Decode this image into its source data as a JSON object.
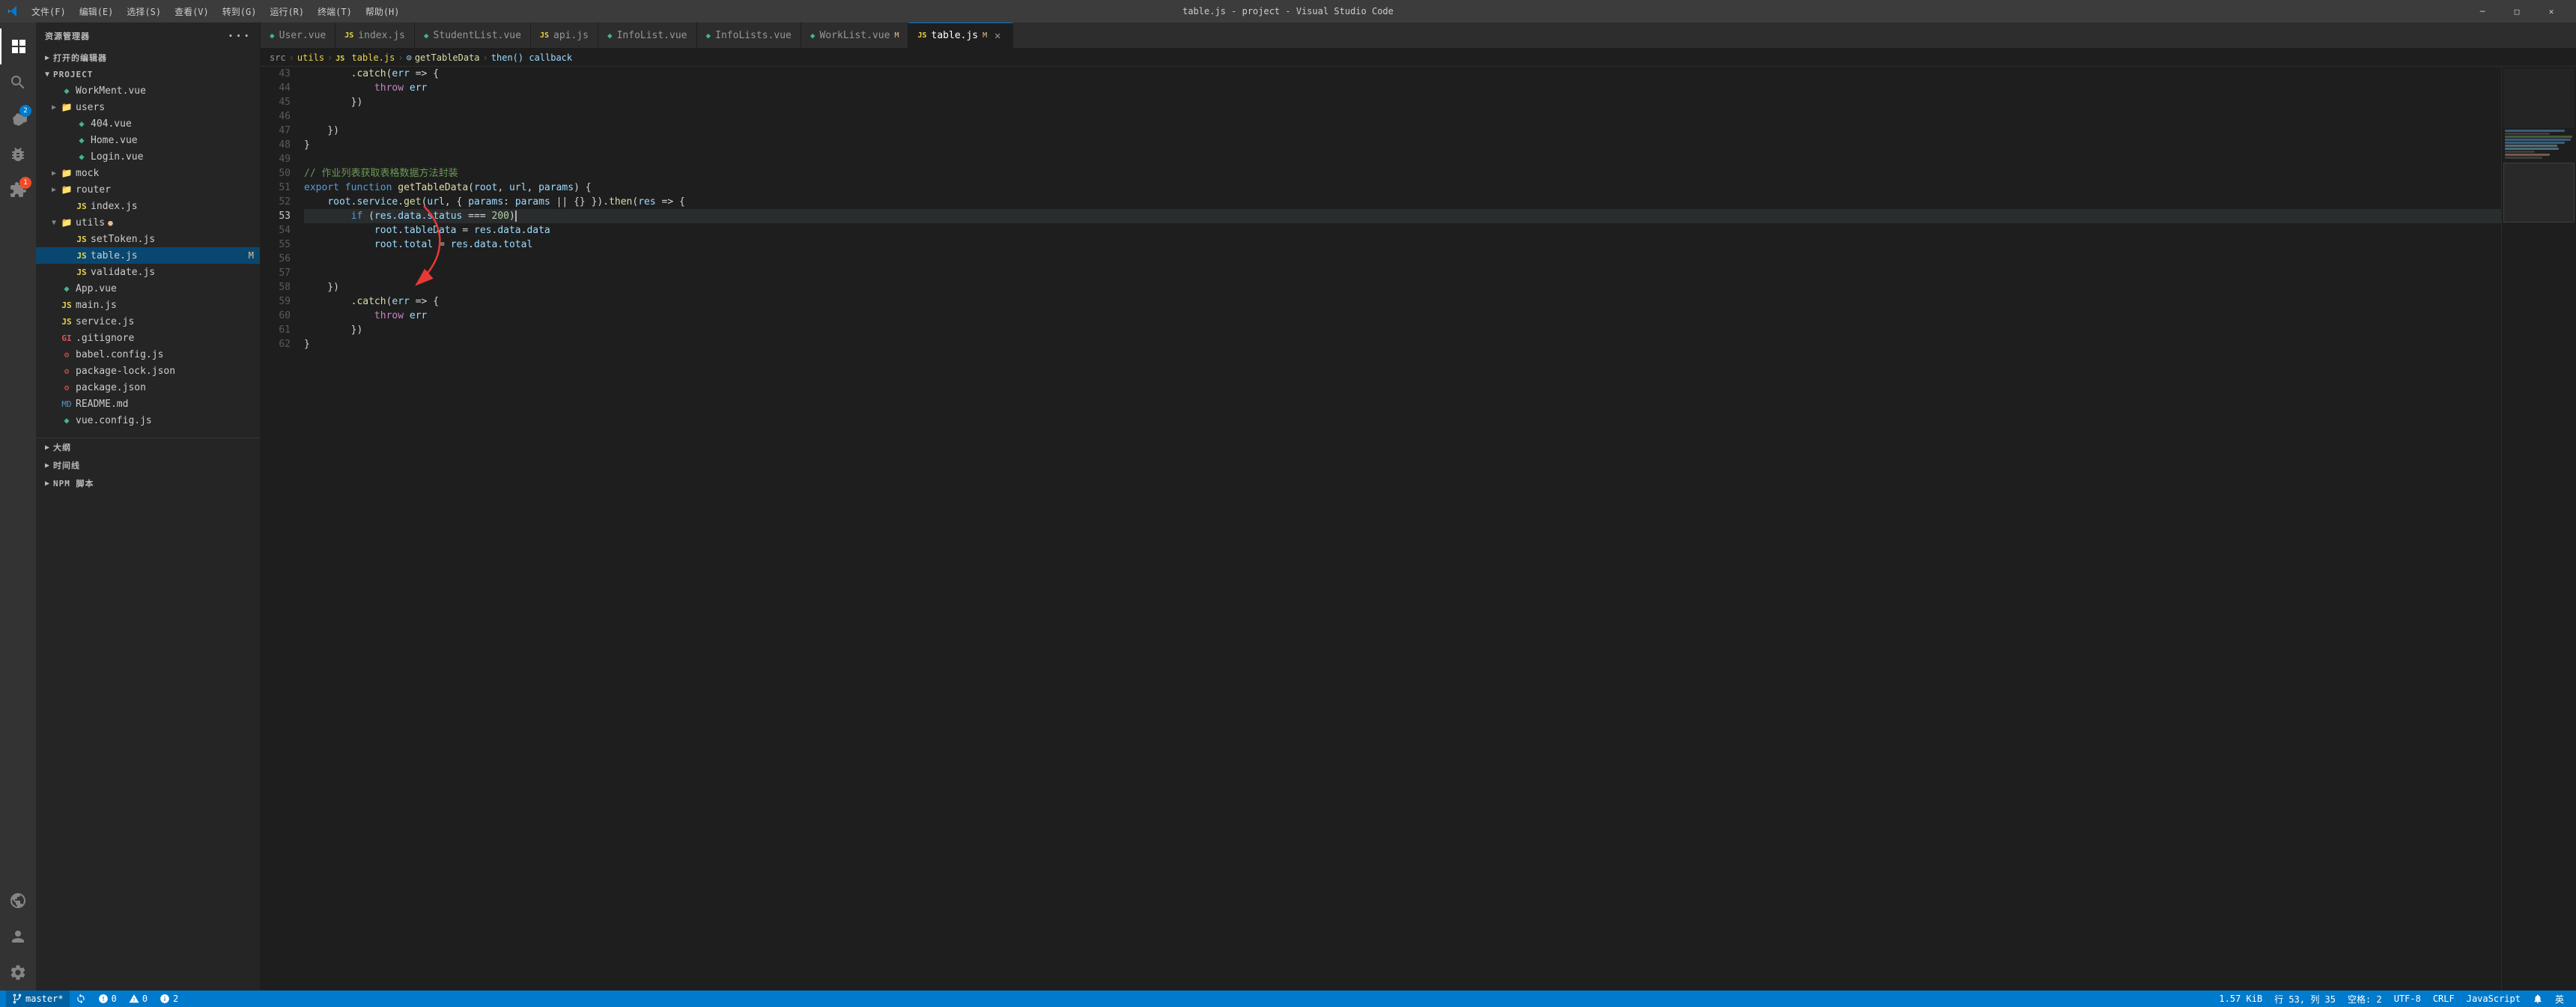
{
  "titleBar": {
    "title": "table.js - project - Visual Studio Code",
    "menus": [
      "文件(F)",
      "编辑(E)",
      "选择(S)",
      "查看(V)",
      "转到(G)",
      "运行(R)",
      "终端(T)",
      "帮助(H)"
    ]
  },
  "tabs": [
    {
      "id": "user-vue",
      "type": "vue",
      "label": "User.vue",
      "active": false,
      "modified": false
    },
    {
      "id": "index-js",
      "type": "js",
      "label": "index.js",
      "active": false,
      "modified": false
    },
    {
      "id": "studentlist-vue",
      "type": "vue",
      "label": "StudentList.vue",
      "active": false,
      "modified": false
    },
    {
      "id": "api-js",
      "type": "js",
      "label": "api.js",
      "active": false,
      "modified": false
    },
    {
      "id": "infolist-vue",
      "type": "vue",
      "label": "InfoList.vue",
      "active": false,
      "modified": false
    },
    {
      "id": "infolists-vue",
      "type": "vue",
      "label": "InfoLists.vue",
      "active": false,
      "modified": false
    },
    {
      "id": "worklist-vue",
      "type": "vue",
      "label": "WorkList.vue M",
      "active": false,
      "modified": true
    },
    {
      "id": "table-js",
      "type": "js",
      "label": "table.js M",
      "active": true,
      "modified": true
    }
  ],
  "breadcrumb": {
    "items": [
      "src",
      "utils",
      "table.js",
      "getTableData",
      "then() callback"
    ]
  },
  "codeLines": [
    {
      "num": 43,
      "text": "        .catch(err => {"
    },
    {
      "num": 44,
      "text": "            throw err"
    },
    {
      "num": 45,
      "text": "        })"
    },
    {
      "num": 46,
      "text": ""
    },
    {
      "num": 47,
      "text": "    })"
    },
    {
      "num": 48,
      "text": "}"
    },
    {
      "num": 49,
      "text": ""
    },
    {
      "num": 50,
      "text": "// 作业列表获取表格数据方法封装"
    },
    {
      "num": 51,
      "text": "export function getTableData(root, url, params) {"
    },
    {
      "num": 52,
      "text": "    root.service.get(url, { params: params || {} }).then(res => {"
    },
    {
      "num": 53,
      "text": "        if (res.data.status === 200)",
      "active": true
    },
    {
      "num": 54,
      "text": "            root.tableData = res.data.data"
    },
    {
      "num": 55,
      "text": "            root.total = res.data.total"
    },
    {
      "num": 56,
      "text": ""
    },
    {
      "num": 57,
      "text": ""
    },
    {
      "num": 58,
      "text": "    })"
    },
    {
      "num": 59,
      "text": "        .catch(err => {"
    },
    {
      "num": 60,
      "text": "            throw err"
    },
    {
      "num": 61,
      "text": "        })"
    },
    {
      "num": 62,
      "text": "}"
    }
  ],
  "sidebar": {
    "title": "资源管理器",
    "sections": [
      {
        "name": "打开的编辑器",
        "collapsed": true
      },
      {
        "name": "PROJECT",
        "collapsed": false
      }
    ],
    "tree": [
      {
        "indent": 0,
        "type": "folder",
        "label": "WorkMent.vue",
        "icon": "vue",
        "arrow": ""
      },
      {
        "indent": 0,
        "type": "folder",
        "label": "users",
        "icon": "folder",
        "arrow": "▶"
      },
      {
        "indent": 1,
        "type": "file",
        "label": "404.vue",
        "icon": "vue",
        "arrow": ""
      },
      {
        "indent": 1,
        "type": "file",
        "label": "Home.vue",
        "icon": "vue",
        "arrow": ""
      },
      {
        "indent": 1,
        "type": "file",
        "label": "Login.vue",
        "icon": "vue",
        "arrow": ""
      },
      {
        "indent": 0,
        "type": "folder",
        "label": "mock",
        "icon": "folder",
        "arrow": "▶"
      },
      {
        "indent": 0,
        "type": "folder",
        "label": "router",
        "icon": "folder",
        "arrow": "▶"
      },
      {
        "indent": 1,
        "type": "file",
        "label": "index.js",
        "icon": "js",
        "arrow": ""
      },
      {
        "indent": 0,
        "type": "folder",
        "label": "utils",
        "icon": "folder",
        "arrow": "▼",
        "modified": true
      },
      {
        "indent": 1,
        "type": "file",
        "label": "setToken.js",
        "icon": "js",
        "arrow": ""
      },
      {
        "indent": 1,
        "type": "file",
        "label": "table.js",
        "icon": "js",
        "arrow": "",
        "active": true,
        "modified": "M"
      },
      {
        "indent": 1,
        "type": "file",
        "label": "validate.js",
        "icon": "js",
        "arrow": ""
      },
      {
        "indent": 0,
        "type": "file",
        "label": "App.vue",
        "icon": "vue",
        "arrow": ""
      },
      {
        "indent": 0,
        "type": "file",
        "label": "main.js",
        "icon": "js",
        "arrow": ""
      },
      {
        "indent": 0,
        "type": "file",
        "label": "service.js",
        "icon": "js",
        "arrow": ""
      },
      {
        "indent": 0,
        "type": "file",
        "label": ".gitignore",
        "icon": "git",
        "arrow": ""
      },
      {
        "indent": 0,
        "type": "file",
        "label": "babel.config.js",
        "icon": "json-red",
        "arrow": ""
      },
      {
        "indent": 0,
        "type": "file",
        "label": "package-lock.json",
        "icon": "json-red",
        "arrow": ""
      },
      {
        "indent": 0,
        "type": "file",
        "label": "package.json",
        "icon": "json-red",
        "arrow": ""
      },
      {
        "indent": 0,
        "type": "file",
        "label": "README.md",
        "icon": "md",
        "arrow": ""
      },
      {
        "indent": 0,
        "type": "file",
        "label": "vue.config.js",
        "icon": "vue",
        "arrow": ""
      }
    ],
    "bottomItems": [
      "大纲",
      "时间线",
      "NPM 脚本"
    ]
  },
  "statusBar": {
    "branch": "master*",
    "errors": "0",
    "warnings": "0",
    "info": "2",
    "size": "1.57 KiB",
    "line": "行 53, 列 35",
    "spaces": "空格: 2",
    "encoding": "UTF-8",
    "lineEnding": "CRLF",
    "language": "JavaScript",
    "rightItems": [
      "英"
    ]
  },
  "icons": {
    "explorer": "⬡",
    "search": "🔍",
    "git": "⑂",
    "debug": "▷",
    "extensions": "⊞",
    "remote": "⊙",
    "account": "👤",
    "settings": "⚙"
  }
}
